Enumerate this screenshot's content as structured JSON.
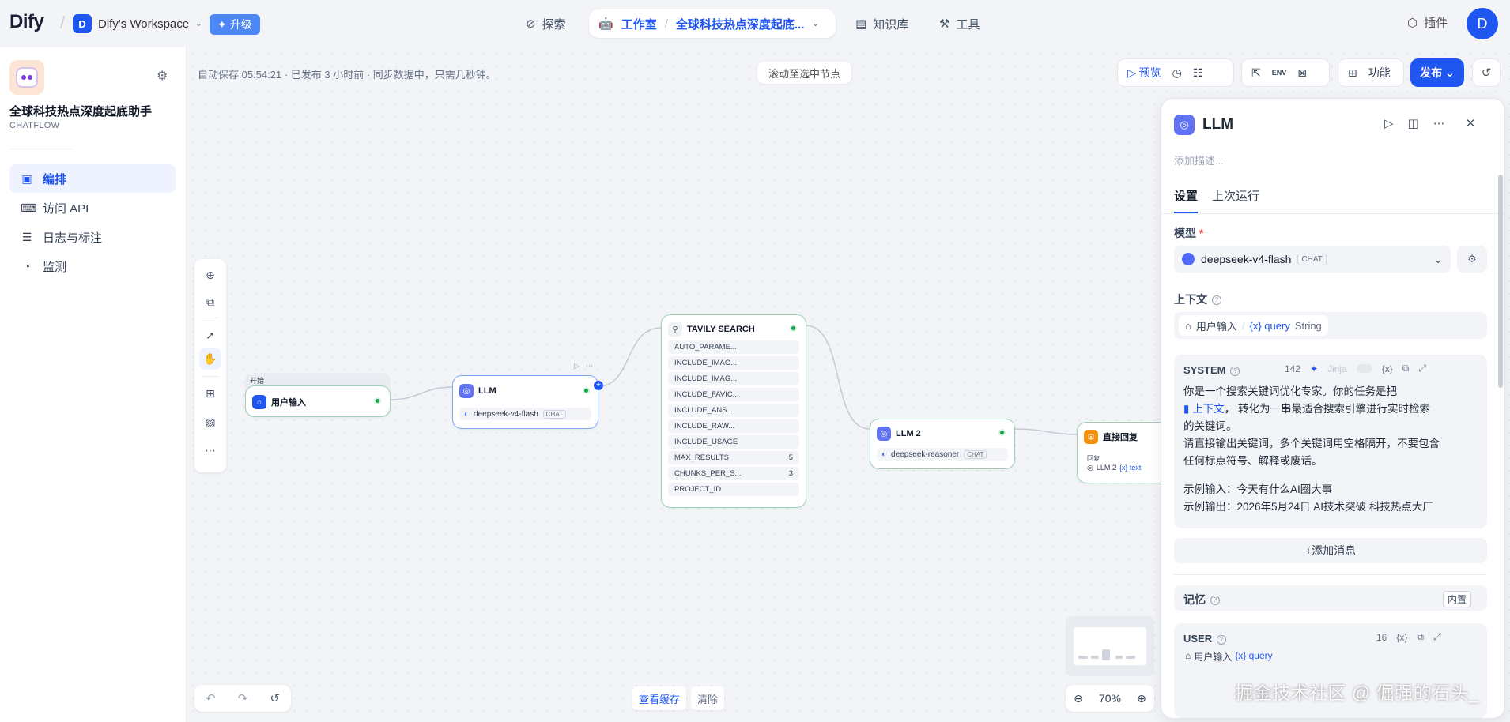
{
  "topbar": {
    "logo": "Dify",
    "workspace_initial": "D",
    "workspace_name": "Dify's Workspace",
    "upgrade": "升级",
    "nav_explore": "探索",
    "nav_studio": "工作室",
    "nav_app": "全球科技热点深度起底...",
    "nav_knowledge": "知识库",
    "nav_tools": "工具",
    "plugins": "插件",
    "user_initial": "D"
  },
  "sidebar": {
    "app_name": "全球科技热点深度起底助手",
    "app_type": "CHATFLOW",
    "items": [
      {
        "label": "编排",
        "icon": "layout-icon"
      },
      {
        "label": "访问 API",
        "icon": "terminal-icon"
      },
      {
        "label": "日志与标注",
        "icon": "document-icon"
      },
      {
        "label": "监测",
        "icon": "gauge-icon"
      }
    ]
  },
  "toolbar": {
    "autosave": "自动保存 05:54:21 · 已发布 3 小时前 · 同步数据中，只需几秒钟。",
    "scroll_to_node": "滚动至选中节点",
    "preview": "预览",
    "env": "ENV",
    "features": "功能",
    "publish": "发布"
  },
  "nodes": {
    "start": {
      "caption": "开始",
      "title": "用户输入"
    },
    "llm1": {
      "title": "LLM",
      "model": "deepseek-v4-flash",
      "tag": "CHAT"
    },
    "tavily": {
      "title": "TAVILY SEARCH",
      "params": [
        {
          "name": "AUTO_PARAME...",
          "value": ""
        },
        {
          "name": "INCLUDE_IMAG...",
          "value": ""
        },
        {
          "name": "INCLUDE_IMAG...",
          "value": ""
        },
        {
          "name": "INCLUDE_FAVIC...",
          "value": ""
        },
        {
          "name": "INCLUDE_ANS...",
          "value": ""
        },
        {
          "name": "INCLUDE_RAW...",
          "value": ""
        },
        {
          "name": "INCLUDE_USAGE",
          "value": ""
        },
        {
          "name": "MAX_RESULTS",
          "value": "5"
        },
        {
          "name": "CHUNKS_PER_S...",
          "value": "3"
        },
        {
          "name": "PROJECT_ID",
          "value": ""
        }
      ]
    },
    "llm2": {
      "title": "LLM 2",
      "model": "deepseek-reasoner",
      "tag": "CHAT"
    },
    "answer": {
      "title": "直接回复",
      "caption": "回复",
      "ref_node": "LLM 2",
      "ref_var": "{x} text"
    }
  },
  "bottom": {
    "view_cache": "查看缓存",
    "clear": "清除",
    "zoom": "70%"
  },
  "panel": {
    "title": "LLM",
    "desc_placeholder": "添加描述...",
    "tab_settings": "设置",
    "tab_last_run": "上次运行",
    "model_label": "模型",
    "model_name": "deepseek-v4-flash",
    "model_tag": "CHAT",
    "context_label": "上下文",
    "context_node": "用户输入",
    "context_var": "{x} query",
    "context_type": "String",
    "system_label": "SYSTEM",
    "system_count": "142",
    "jinja": "Jinja",
    "var_btn": "{x}",
    "system_line1": "你是一个搜索关键词优化专家。你的任务是把",
    "system_ctx": "上下文",
    "system_line2": "，  转化为一串最适合搜索引擎进行实时检索",
    "system_line3": "的关键词。",
    "system_line4": "请直接输出关键词，多个关键词用空格隔开，不要包含",
    "system_line5": "任何标点符号、解释或废话。",
    "system_line6": "示例输入：今天有什么AI圈大事",
    "system_line7": "示例输出：2026年5月24日 AI技术突破 科技热点大厂",
    "add_message": "添加消息",
    "memory_label": "记忆",
    "memory_tag": "内置",
    "user_label": "USER",
    "user_count": "16",
    "user_node": "用户输入",
    "user_var": "{x} query"
  },
  "watermark": "掘金技术社区 @ 倔强的石头_"
}
